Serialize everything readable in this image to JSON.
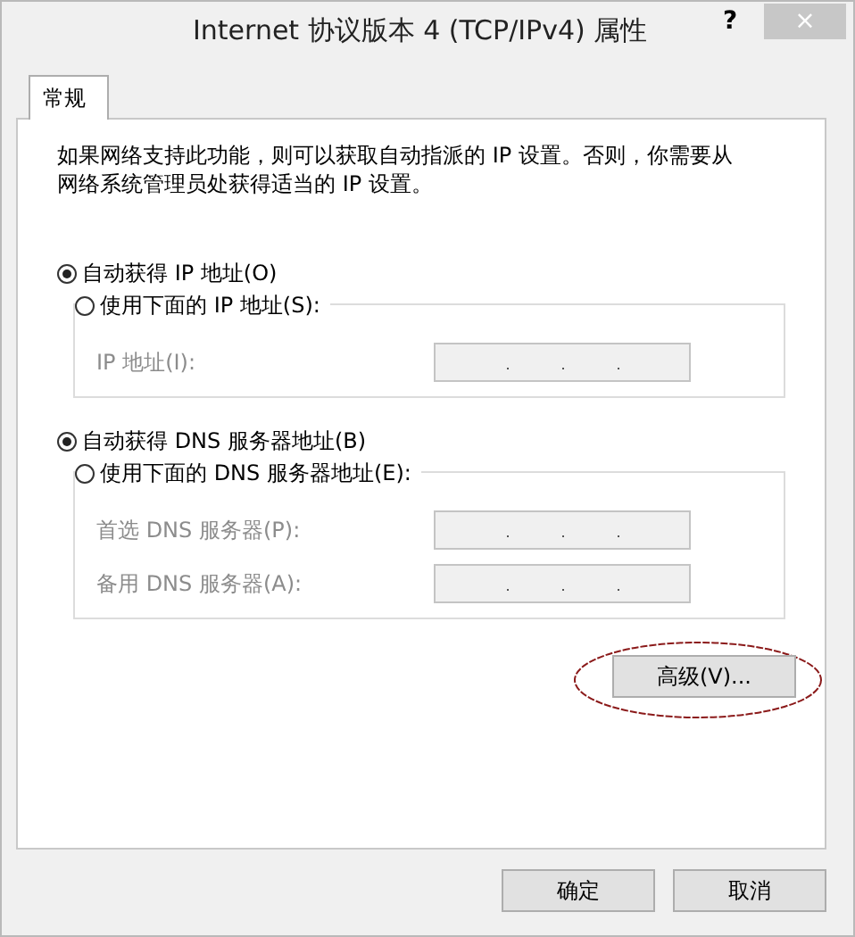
{
  "window": {
    "title": "Internet 协议版本 4 (TCP/IPv4) 属性",
    "help": "?",
    "close": "×"
  },
  "tabs": [
    {
      "label": "常规",
      "selected": true
    }
  ],
  "description": "如果网络支持此功能，则可以获取自动指派的 IP 设置。否则，你需要从网络系统管理员处获得适当的 IP 设置。",
  "sections": [
    {
      "auto": {
        "label": "自动获得 IP 地址(O)",
        "selected": true
      },
      "manual": {
        "label": "使用下面的 IP 地址(S):",
        "selected": false
      },
      "fields": [
        {
          "label": "IP 地址(I):",
          "disabled": true
        }
      ]
    },
    {
      "auto": {
        "label": "自动获得 DNS 服务器地址(B)",
        "selected": true
      },
      "manual": {
        "label": "使用下面的 DNS 服务器地址(E):",
        "selected": false
      },
      "fields": [
        {
          "label": "首选 DNS 服务器(P):",
          "disabled": true
        },
        {
          "label": "备用 DNS 服务器(A):",
          "disabled": true
        }
      ]
    }
  ],
  "advanced_button": {
    "label": "高级(V)...",
    "highlighted": true
  },
  "buttons": [
    "确定",
    "取消"
  ]
}
